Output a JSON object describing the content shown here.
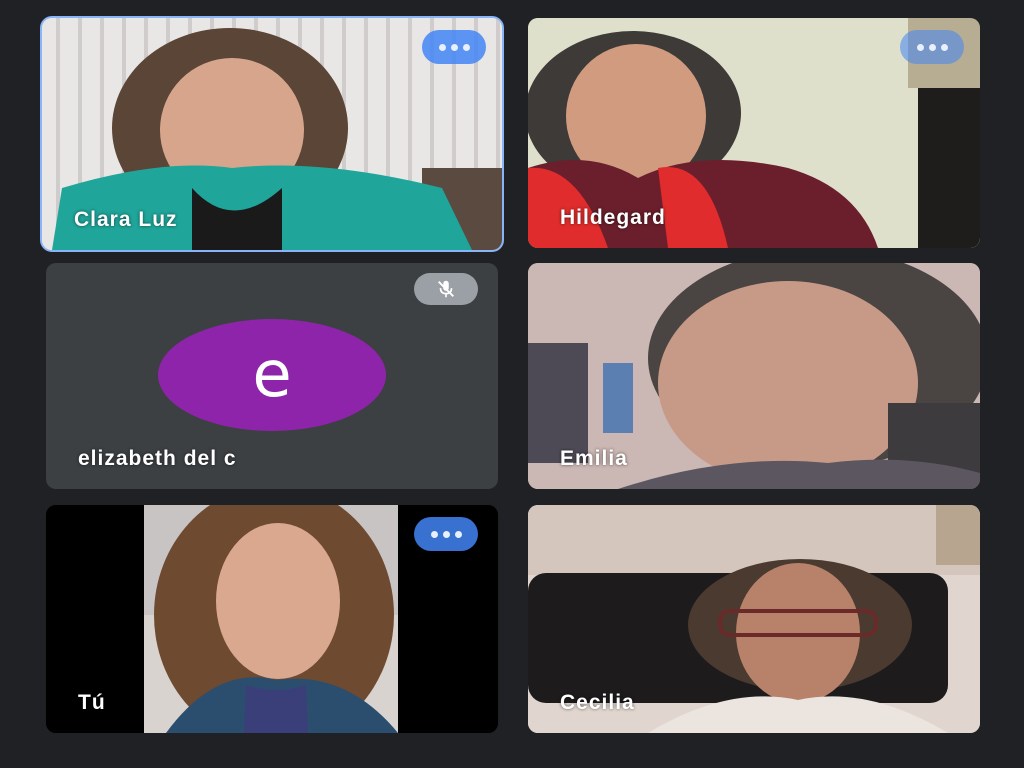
{
  "colors": {
    "background": "#202124",
    "active_border": "#8ab4f8",
    "avatar_purple": "#8e24aa",
    "control_blue": "#4285f4"
  },
  "participants": [
    {
      "name": "Clara Luz",
      "active": true,
      "video": true,
      "icon": "more-options-icon"
    },
    {
      "name": "Hildegard",
      "active": false,
      "video": true,
      "icon": "more-options-icon"
    },
    {
      "name": "elizabeth del c",
      "active": false,
      "video": false,
      "avatar_letter": "e",
      "icon": "mic-off-icon"
    },
    {
      "name": "Emilia",
      "active": false,
      "video": true
    },
    {
      "name": "Tú",
      "active": false,
      "video": true,
      "icon": "more-options-icon"
    },
    {
      "name": "Cecilia",
      "active": false,
      "video": true
    }
  ]
}
